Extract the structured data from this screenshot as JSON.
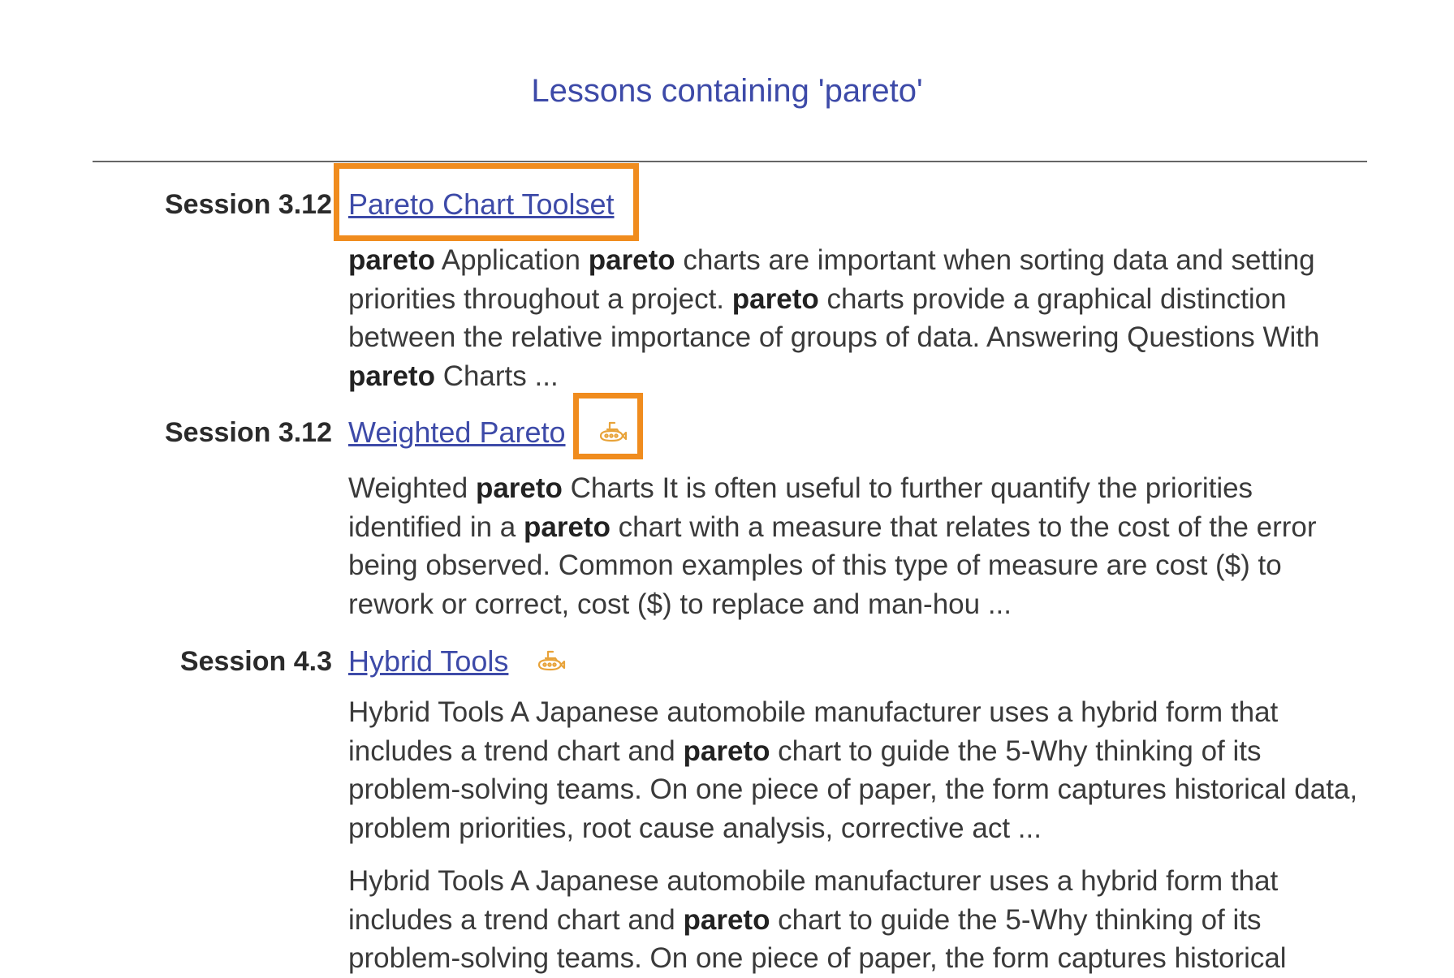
{
  "page": {
    "title": "Lessons containing 'pareto'"
  },
  "results": [
    {
      "session": "Session 3.12",
      "link": "Pareto Chart Toolset",
      "has_icon": false,
      "snippets": [
        [
          {
            "t": "pareto",
            "b": true
          },
          {
            "t": " Application ",
            "b": false
          },
          {
            "t": "pareto",
            "b": true
          },
          {
            "t": " charts are important when sorting data and setting priorities throughout a project. ",
            "b": false
          },
          {
            "t": "pareto",
            "b": true
          },
          {
            "t": " charts provide a graphical distinction between the relative importance of groups of data. Answering Questions With ",
            "b": false
          },
          {
            "t": "pareto",
            "b": true
          },
          {
            "t": " Charts ...",
            "b": false
          }
        ]
      ]
    },
    {
      "session": "Session 3.12",
      "link": "Weighted Pareto ",
      "has_icon": true,
      "icon": "submarine-icon",
      "snippets": [
        [
          {
            "t": "Weighted ",
            "b": false
          },
          {
            "t": "pareto",
            "b": true
          },
          {
            "t": " Charts It is often useful to further quantify the priorities identified in a ",
            "b": false
          },
          {
            "t": "pareto",
            "b": true
          },
          {
            "t": " chart with a measure that relates to the cost of the error being observed. Common examples of this type of measure are cost ($) to rework or correct, cost ($) to replace and man-hou ...",
            "b": false
          }
        ]
      ]
    },
    {
      "session": "Session 4.3",
      "link": "Hybrid Tools ",
      "has_icon": true,
      "icon": "submarine-icon",
      "snippets": [
        [
          {
            "t": "Hybrid Tools A Japanese automobile manufacturer uses a hybrid form that includes a trend chart and ",
            "b": false
          },
          {
            "t": "pareto",
            "b": true
          },
          {
            "t": " chart to guide the 5-Why thinking of its problem-solving teams. On one piece of paper, the form captures historical data, problem priorities, root cause analysis, corrective act ...",
            "b": false
          }
        ],
        [
          {
            "t": "Hybrid Tools A Japanese automobile manufacturer uses a hybrid form that includes a trend chart and ",
            "b": false
          },
          {
            "t": "pareto",
            "b": true
          },
          {
            "t": " chart to guide the 5-Why thinking of its problem-solving teams. On one piece of paper, the form captures historical",
            "b": false
          }
        ]
      ]
    }
  ],
  "colors": {
    "link": "#3d4aa8",
    "highlight": "#f08c1e",
    "icon": "#e8a33a"
  }
}
